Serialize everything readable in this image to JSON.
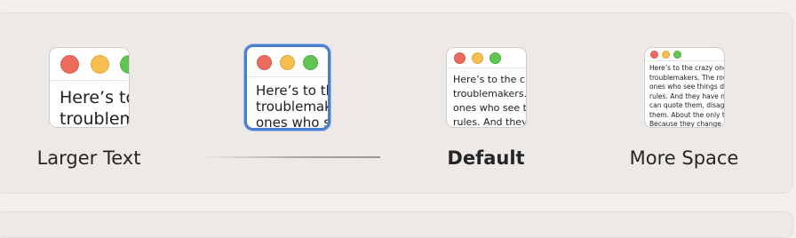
{
  "display_options": [
    {
      "id": "larger-text",
      "label": "Larger Text",
      "selected": false,
      "sample_text": "Here’s to the crazy ones.\ntroublemakers."
    },
    {
      "id": "medium",
      "label": "",
      "selected": true,
      "sample_text": "Here’s to the crazy ones.\ntroublemakers. The\nones who see things"
    },
    {
      "id": "default",
      "label": "Default",
      "selected": false,
      "sample_text": "Here’s to the crazy ones.\ntroublemakers. The\nones who see things\nrules. And they have"
    },
    {
      "id": "more-space",
      "label": "More Space",
      "selected": false,
      "sample_text": "Here’s to the crazy ones.\ntroublemakers. The round pegs\nones who see things differently.\nrules. And they have no respect\ncan quote them, disagree with\nthem. About the only thing you\nBecause they change things."
    }
  ],
  "colors": {
    "selection_accent": "#4a7fd0",
    "traffic_red": "#ec6a5e",
    "traffic_yellow": "#f4bf4f",
    "traffic_green": "#61c554"
  },
  "icons": [
    "window-preview-icon",
    "close-dot",
    "minimize-dot",
    "zoom-dot"
  ]
}
